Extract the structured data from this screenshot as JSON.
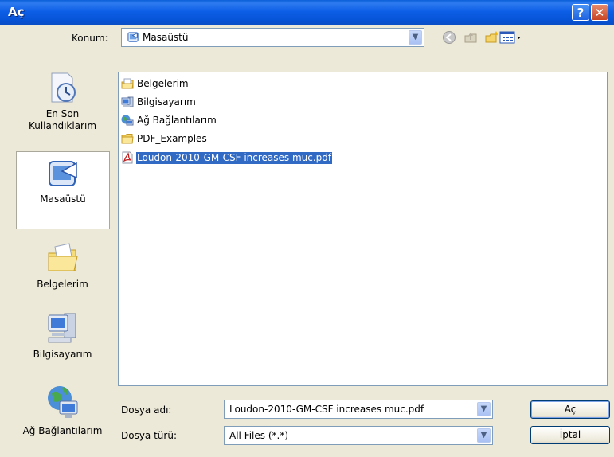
{
  "window": {
    "title": "Aç"
  },
  "titlebar": {
    "help_label": "?",
    "close_label": "✕"
  },
  "location": {
    "label": "Konum:",
    "value": "Masaüstü",
    "icon": "desktop-icon"
  },
  "toolbar": {
    "icons": [
      "back-icon",
      "up-folder-icon",
      "new-folder-icon",
      "view-menu-icon"
    ]
  },
  "places": [
    {
      "label_line1": "En Son",
      "label_line2": "Kullandıklarım",
      "icon": "recent-documents-icon"
    },
    {
      "label_line1": "Masaüstü",
      "label_line2": "",
      "icon": "desktop-icon",
      "selected": true
    },
    {
      "label_line1": "Belgelerim",
      "label_line2": "",
      "icon": "my-documents-icon"
    },
    {
      "label_line1": "Bilgisayarım",
      "label_line2": "",
      "icon": "my-computer-icon"
    },
    {
      "label_line1": "Ağ Bağlantılarım",
      "label_line2": "",
      "icon": "network-places-icon"
    }
  ],
  "files": [
    {
      "name": "Belgelerim",
      "icon": "my-documents-icon"
    },
    {
      "name": "Bilgisayarım",
      "icon": "my-computer-icon"
    },
    {
      "name": "Ağ Bağlantılarım",
      "icon": "network-places-icon"
    },
    {
      "name": "PDF_Examples",
      "icon": "folder-icon"
    },
    {
      "name": "Loudon-2010-GM-CSF increases muc.pdf",
      "icon": "pdf-file-icon",
      "selected": true
    }
  ],
  "filename": {
    "label": "Dosya adı:",
    "value": "Loudon-2010-GM-CSF increases muc.pdf"
  },
  "filetype": {
    "label": "Dosya türü:",
    "value": "All Files (*.*)"
  },
  "buttons": {
    "open": "Aç",
    "cancel": "İptal"
  },
  "colors": {
    "titlebar": "#0a5fd8",
    "selection": "#316ac5",
    "dialog_bg": "#ece9d8"
  }
}
